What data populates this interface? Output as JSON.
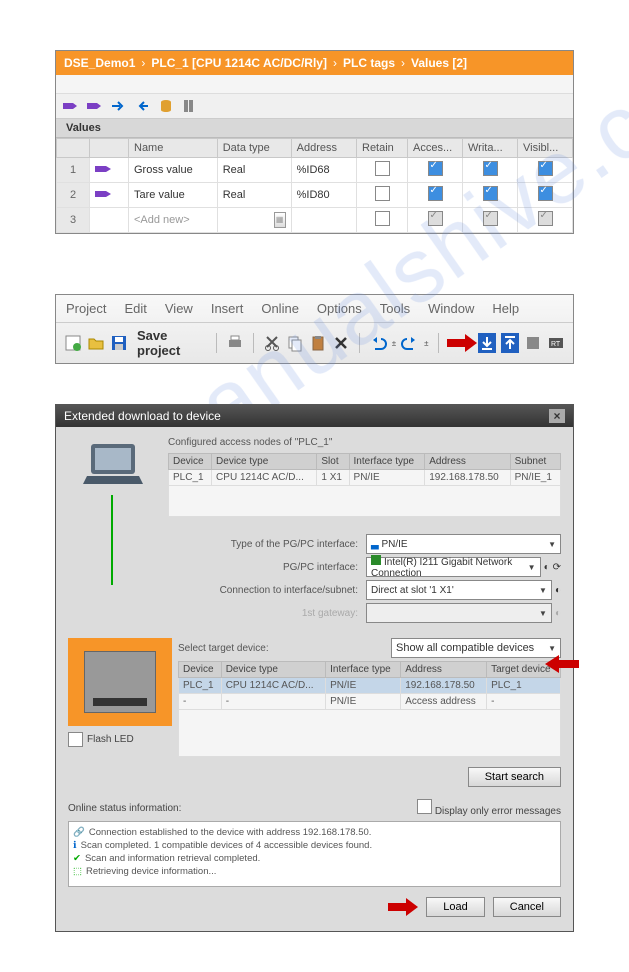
{
  "breadcrumb": [
    "DSE_Demo1",
    "PLC_1 [CPU 1214C AC/DC/Rly]",
    "PLC tags",
    "Values [2]"
  ],
  "sectionTitle": "Values",
  "tagTable": {
    "headers": [
      "",
      "",
      "Name",
      "Data type",
      "Address",
      "Retain",
      "Acces...",
      "Writa...",
      "Visibl..."
    ],
    "rows": [
      {
        "num": "1",
        "name": "Gross value",
        "type": "Real",
        "addr": "%ID68",
        "retain": false,
        "acc": true,
        "wr": true,
        "vis": true
      },
      {
        "num": "2",
        "name": "Tare value",
        "type": "Real",
        "addr": "%ID80",
        "retain": false,
        "acc": true,
        "wr": true,
        "vis": true
      }
    ],
    "addNew": "<Add new>"
  },
  "menus": [
    "Project",
    "Edit",
    "View",
    "Insert",
    "Online",
    "Options",
    "Tools",
    "Window",
    "Help"
  ],
  "saveProject": "Save project",
  "dialog": {
    "title": "Extended download to device",
    "cfgLabel": "Configured access nodes of \"PLC_1\"",
    "cfgHeaders": [
      "Device",
      "Device type",
      "Slot",
      "Interface type",
      "Address",
      "Subnet"
    ],
    "cfgRow": {
      "device": "PLC_1",
      "dtype": "CPU 1214C AC/D...",
      "slot": "1 X1",
      "itype": "PN/IE",
      "addr": "192.168.178.50",
      "subnet": "PN/IE_1"
    },
    "labels": {
      "pgpcType": "Type of the PG/PC interface:",
      "pgpcIf": "PG/PC interface:",
      "conn": "Connection to interface/subnet:",
      "gw": "1st gateway:"
    },
    "vals": {
      "pgpcType": "PN/IE",
      "pgpcIf": "Intel(R) I211 Gigabit Network Connection",
      "conn": "Direct at slot '1 X1'"
    },
    "selTarget": "Select target device:",
    "showAll": "Show all compatible devices",
    "tgtHeaders": [
      "Device",
      "Device type",
      "Interface type",
      "Address",
      "Target device"
    ],
    "tgtRows": [
      {
        "device": "PLC_1",
        "dtype": "CPU 1214C AC/D...",
        "itype": "PN/IE",
        "addr": "192.168.178.50",
        "tgt": "PLC_1"
      },
      {
        "device": "-",
        "dtype": "-",
        "itype": "PN/IE",
        "addr": "Access address",
        "tgt": "-"
      }
    ],
    "flashLED": "Flash LED",
    "startSearch": "Start search",
    "onlineStatus": "Online status information:",
    "onlyErrors": "Display only error messages",
    "statusLines": [
      "Connection established to the device with address 192.168.178.50.",
      "Scan completed. 1 compatible devices of 4 accessible devices found.",
      "Scan and information retrieval completed.",
      "Retrieving device information..."
    ],
    "load": "Load",
    "cancel": "Cancel"
  }
}
